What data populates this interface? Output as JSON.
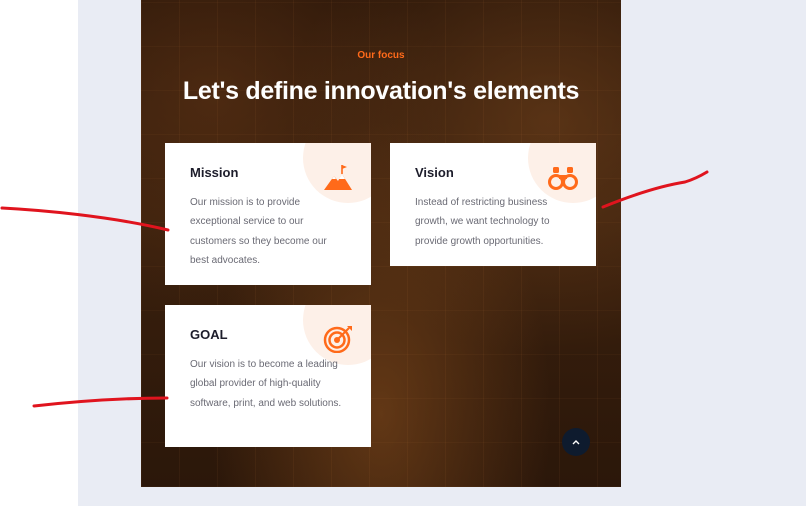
{
  "hero": {
    "eyebrow": "Our focus",
    "title": "Let's define innovation's elements"
  },
  "cards": [
    {
      "title": "Mission",
      "text": "Our mission is to provide exceptional service to our customers so they become our best advocates.",
      "icon": "mountain-flag-icon"
    },
    {
      "title": "Vision",
      "text": "Instead of restricting business growth, we want technology to provide growth opportunities.",
      "icon": "binoculars-icon"
    },
    {
      "title": "GOAL",
      "text": "Our vision is to become a leading global provider of high-quality software, print, and web solutions.",
      "icon": "target-arrow-icon"
    }
  ],
  "scroll_top": {
    "icon": "chevron-up-icon"
  },
  "colors": {
    "accent": "#ff6a1a",
    "annotation": "#e0141e",
    "hero_bg": "#2a1609",
    "page_bg": "#e9ecf4",
    "button_bg": "#0e1b2e"
  }
}
